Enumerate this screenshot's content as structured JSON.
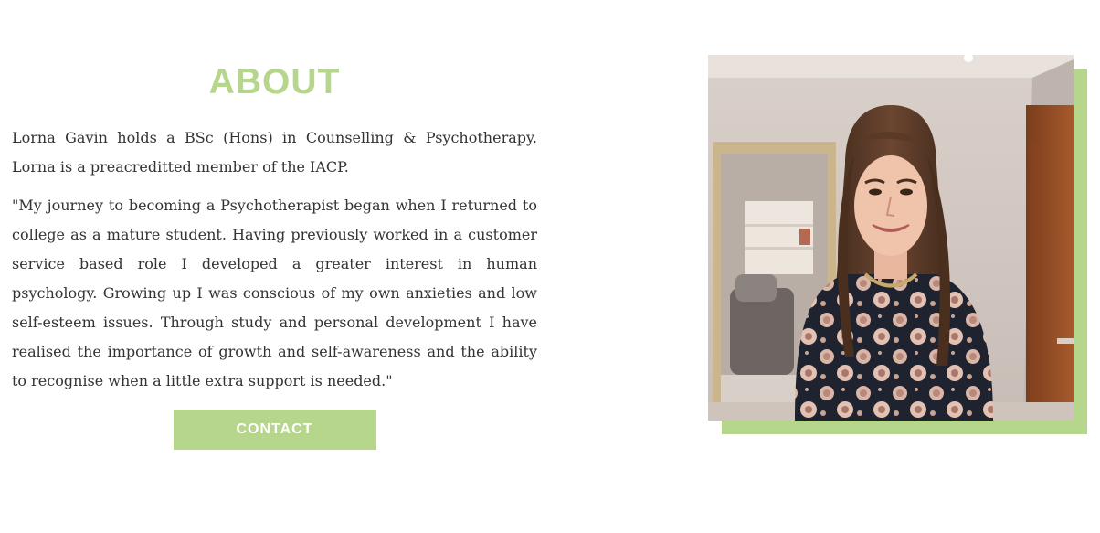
{
  "about": {
    "title": "ABOUT",
    "paragraph_1": "Lorna Gavin holds a BSc (Hons) in Counselling & Psychotherapy. Lorna is a preacreditted member of the IACP.",
    "paragraph_2": "\"My journey to becoming a Psychotherapist began when I returned to college as a mature student. Having previously worked in a customer service based role I developed a greater interest in human psychology. Growing up I was conscious of my own anxieties and low self-esteem issues. Through study and personal development I have realised the importance of growth and self-awareness and the ability to recognise when a little extra support is needed.\"",
    "contact_label": "CONTACT"
  },
  "colors": {
    "accent": "#b5d68b",
    "text": "#333333",
    "background": "#ffffff"
  }
}
